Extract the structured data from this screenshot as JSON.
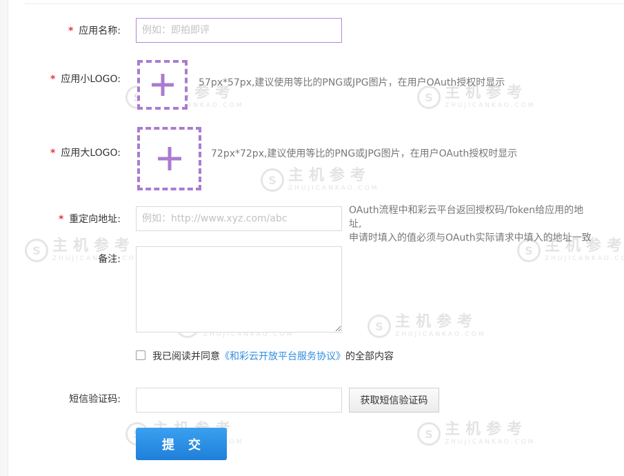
{
  "form": {
    "app_name": {
      "label": "应用名称:",
      "placeholder": "例如：即拍即评"
    },
    "small_logo": {
      "label": "应用小LOGO:",
      "hint": "57px*57px,建议使用等比的PNG或JPG图片，在用户OAuth授权时显示"
    },
    "large_logo": {
      "label": "应用大LOGO:",
      "hint": "72px*72px,建议使用等比的PNG或JPG图片，在用户OAuth授权时显示"
    },
    "redirect": {
      "label": "重定向地址:",
      "placeholder": "例如：http://www.xyz.com/abc",
      "hint_line1": "OAuth流程中和彩云平台返回授权码/Token给应用的地",
      "hint_line2": "址,",
      "hint_line3": "申请时填入的值必须与OAuth实际请求中填入的地址一致"
    },
    "remark": {
      "label": "备注:"
    },
    "agreement": {
      "prefix": "我已阅读并同意",
      "link": "《和彩云开放平台服务协议》",
      "suffix": "的全部内容",
      "checked": false
    },
    "sms": {
      "label": "短信验证码:",
      "button": "获取短信验证码"
    },
    "submit": {
      "label": "提交"
    },
    "required_mark": "*"
  },
  "watermark": {
    "cn": "主机参考",
    "en": "ZHUJICANKAO.COM",
    "logo_glyph": "S"
  },
  "colors": {
    "accent_purple": "#a97cd0",
    "required_red": "#e4393c",
    "link_blue": "#2f8ee0",
    "submit_blue": "#1f7fd9"
  }
}
